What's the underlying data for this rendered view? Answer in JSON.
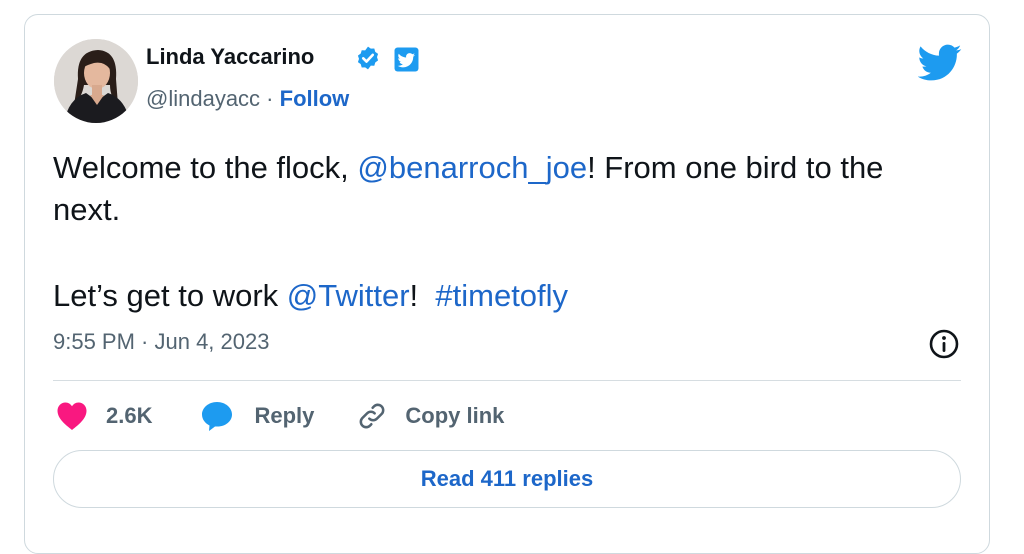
{
  "author": {
    "name": "Linda Yaccarino",
    "handle": "@lindayacc",
    "separator": " · ",
    "follow_label": "Follow",
    "avatar_icon": "profile-photo",
    "verified_icon": "verified-badge-icon",
    "affiliate_icon": "twitter-affiliate-badge-icon"
  },
  "tweet": {
    "line1_prefix": "Welcome to the flock, ",
    "mention1": "@benarroch_joe",
    "line1_suffix": "! From one bird to the next.",
    "line2_prefix": "Let’s get to work ",
    "mention2": "@Twitter",
    "line2_middle": "!  ",
    "hashtag": "#timetofly",
    "timestamp": "9:55 PM · Jun 4, 2023"
  },
  "actions": {
    "likes": "2.6K",
    "reply_label": "Reply",
    "copy_label": "Copy link"
  },
  "read_replies_label": "Read 411 replies",
  "colors": {
    "link": "#1d67c9",
    "twitter_blue": "#1d9bf0",
    "heart": "#f91880",
    "muted": "#536471",
    "border": "#cfd9de"
  }
}
